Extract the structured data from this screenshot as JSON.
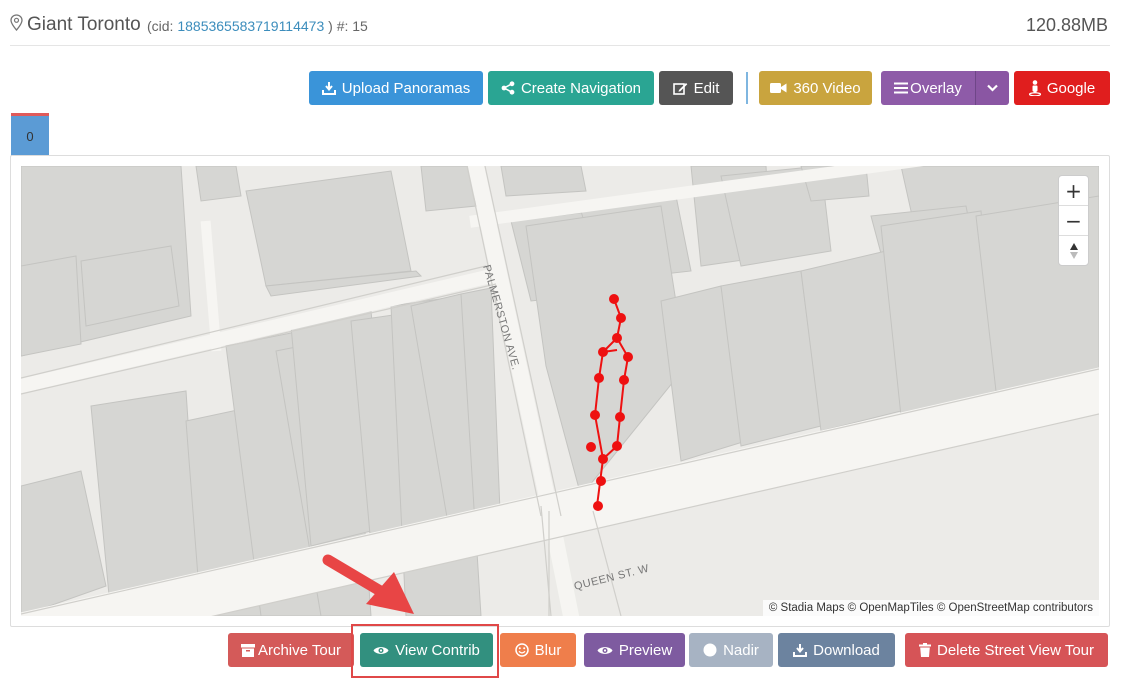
{
  "header": {
    "title": "Giant Toronto",
    "cid_prefix": "(cid:",
    "cid_value": "1885365583719114473",
    "cid_suffix": ") #: 15",
    "size": "120.88MB"
  },
  "toolbar": {
    "upload": "Upload Panoramas",
    "create_nav": "Create Navigation",
    "edit": "Edit",
    "video": "360 Video",
    "overlay": "Overlay",
    "google": "Google"
  },
  "tabs": [
    {
      "label": "0"
    }
  ],
  "map": {
    "street_1": "PALMERSTON AVE.",
    "street_2": "QUEEN ST. W",
    "zoom_in": "+",
    "zoom_out": "−",
    "attribution": "© Stadia Maps © OpenMapTiles © OpenStreetMap contributors"
  },
  "actions": {
    "archive": "Archive Tour",
    "view_contrib": "View Contrib",
    "blur": "Blur",
    "preview": "Preview",
    "nadir": "Nadir",
    "download": "Download",
    "delete": "Delete Street View Tour"
  },
  "colors": {
    "blue": "#3a94d9",
    "teal": "#2aa593",
    "dark": "#555555",
    "gold": "#c9a43e",
    "purple": "#8e5ba8",
    "red": "#e01e1e",
    "archive_red": "#d45a59",
    "view_teal": "#32907f",
    "orange": "#ef7e4b",
    "preview_purple": "#7e5ba0",
    "nadir_gray": "#a7b3c3",
    "download_slate": "#6c839f",
    "delete_red": "#d65457",
    "track_red": "#ee1111"
  }
}
